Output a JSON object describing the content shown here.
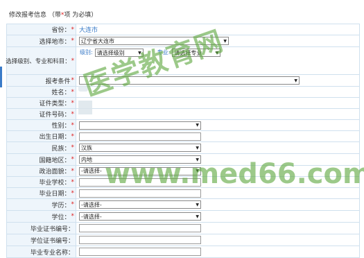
{
  "header": {
    "title": "修改报考信息",
    "note_prefix": "（带",
    "note_star": "*",
    "note_suffix": "项 为必填）"
  },
  "form": {
    "province": {
      "label": "省份：",
      "required": "*",
      "value": "大连市"
    },
    "city": {
      "label": "选择地市：",
      "required": "*",
      "value": "辽宁省大连市"
    },
    "level_subject": {
      "label": "选择级别、专业和科目：",
      "required": "*",
      "level_label": "级别:",
      "level_value": "请选择级别",
      "major_label": "专业:",
      "major_value": "请选择专业"
    },
    "exam_condition": {
      "label": "报考条件",
      "required": "*",
      "value": ""
    },
    "name": {
      "label": "姓名：",
      "required": "*"
    },
    "id_type": {
      "label": "证件类型：",
      "required": "*"
    },
    "id_number": {
      "label": "证件号码：",
      "required": "*"
    },
    "gender": {
      "label": "性别：",
      "required": "*",
      "value": ""
    },
    "birth_date": {
      "label": "出生日期：",
      "required": "*"
    },
    "ethnicity": {
      "label": "民族：",
      "required": "*",
      "value": "汉族"
    },
    "nationality": {
      "label": "国籍地区：",
      "required": "*",
      "value": "内地"
    },
    "political": {
      "label": "政治面貌：",
      "required": "*",
      "value": "-请选择-"
    },
    "school": {
      "label": "毕业学校：",
      "required": "*"
    },
    "grad_date": {
      "label": "毕业日期：",
      "required": "*"
    },
    "education": {
      "label": "学历：",
      "required": "*",
      "value": "-请选择-"
    },
    "degree": {
      "label": "学位：",
      "required": "*",
      "value": "-请选择-"
    },
    "grad_cert": {
      "label": "毕业证书编号："
    },
    "degree_cert": {
      "label": "学位证书编号："
    },
    "grad_major": {
      "label": "毕业专业名称："
    }
  },
  "watermark": {
    "text1": "医学教育网",
    "text2": "www.med66.com"
  }
}
